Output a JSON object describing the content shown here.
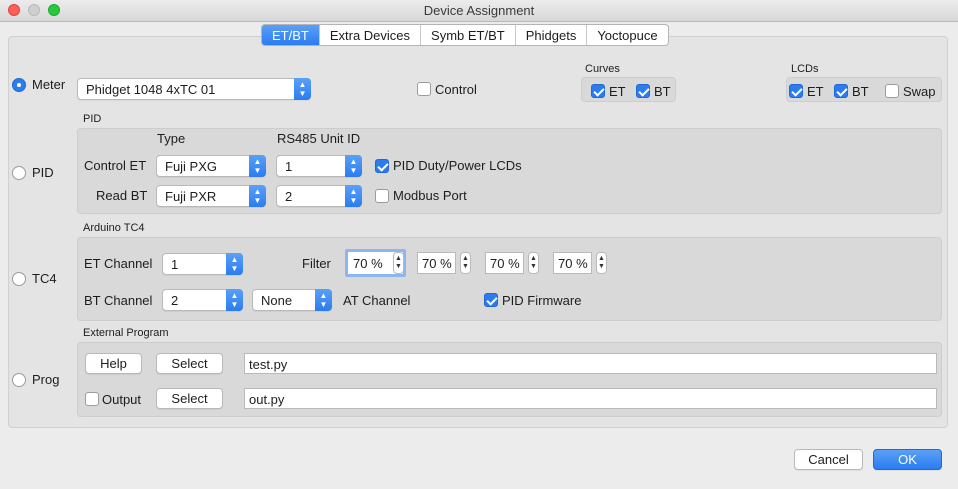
{
  "window": {
    "title": "Device Assignment"
  },
  "tabs": [
    "ET/BT",
    "Extra Devices",
    "Symb ET/BT",
    "Phidgets",
    "Yoctopuce"
  ],
  "meter": {
    "radio_label": "Meter",
    "device": "Phidget 1048 4xTC 01",
    "control_label": "Control",
    "curves_title": "Curves",
    "curves_et": "ET",
    "curves_bt": "BT",
    "lcds_title": "LCDs",
    "lcds_et": "ET",
    "lcds_bt": "BT",
    "lcds_swap": "Swap"
  },
  "pid": {
    "radio_label": "PID",
    "group_title": "PID",
    "type_header": "Type",
    "unit_header": "RS485 Unit ID",
    "control_et_label": "Control ET",
    "control_et_type": "Fuji PXG",
    "control_et_unit": "1",
    "read_bt_label": "Read BT",
    "read_bt_type": "Fuji PXR",
    "read_bt_unit": "2",
    "duty_label": "PID Duty/Power LCDs",
    "modbus_label": "Modbus Port"
  },
  "tc4": {
    "radio_label": "TC4",
    "group_title": "Arduino TC4",
    "et_channel_label": "ET Channel",
    "et_channel": "1",
    "bt_channel_label": "BT Channel",
    "bt_channel": "2",
    "at_channel_value": "None",
    "at_channel_label": "AT Channel",
    "filter_label": "Filter",
    "filters": [
      "70 %",
      "70 %",
      "70 %",
      "70 %"
    ],
    "pid_firmware_label": "PID Firmware"
  },
  "prog": {
    "radio_label": "Prog",
    "group_title": "External Program",
    "help_label": "Help",
    "select_label": "Select",
    "program": "test.py",
    "output_label": "Output",
    "output_select_label": "Select",
    "output_program": "out.py"
  },
  "footer": {
    "cancel_label": "Cancel",
    "ok_label": "OK"
  },
  "colors": {
    "accent": "#2a7cf0",
    "background": "#ececec"
  }
}
